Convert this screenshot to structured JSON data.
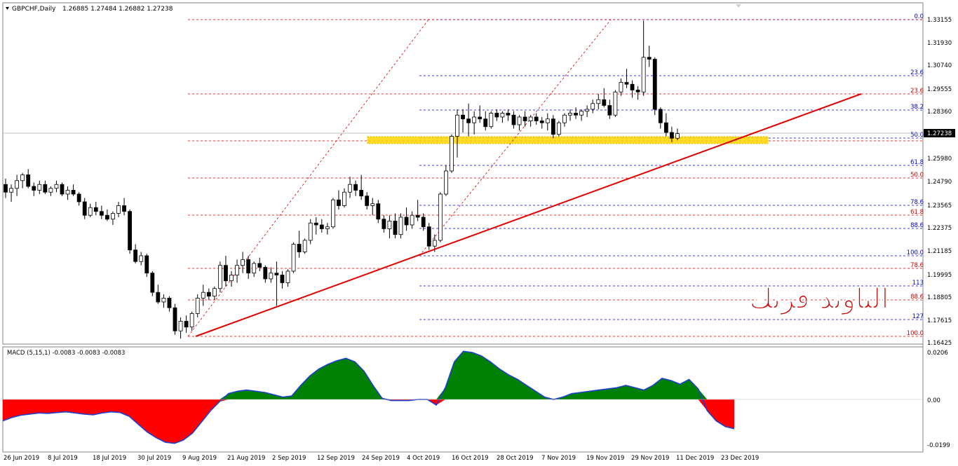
{
  "header": {
    "symbol_label": "GBPCHF,Daily",
    "ohlc_label": "1.26885 1.27484 1.26882 1.27238"
  },
  "macd": {
    "label": "MACD (5,15,1) -0.0083 -0.0083 -0.0083",
    "axis_ticks": [
      "0.0206",
      "0.00",
      "-0.0199"
    ]
  },
  "price_axis": {
    "ticks": [
      "1.33155",
      "1.31930",
      "1.30740",
      "1.29555",
      "1.28360",
      "1.27238",
      "1.25980",
      "1.24790",
      "1.23565",
      "1.22375",
      "1.21185",
      "1.19995",
      "1.18805",
      "1.17615",
      "1.16425"
    ],
    "current_price": "1.27238"
  },
  "time_axis": {
    "labels": [
      "26 Jun 2019",
      "8 Jul 2019",
      "18 Jul 2019",
      "30 Jul 2019",
      "9 Aug 2019",
      "21 Aug 2019",
      "2 Sep 2019",
      "12 Sep 2019",
      "24 Sep 2019",
      "4 Oct 2019",
      "16 Oct 2019",
      "28 Oct 2019",
      "7 Nov 2019",
      "19 Nov 2019",
      "29 Nov 2019",
      "11 Dec 2019",
      "23 Dec 2019"
    ]
  },
  "fib_blue": {
    "label_values": [
      "0.0",
      "23.6",
      "38.2",
      "50.0",
      "61.8",
      "78.6",
      "88.6",
      "100.0",
      "113",
      "127"
    ],
    "color": "#0000cc"
  },
  "fib_red": {
    "label_values": [
      "23.6",
      "50.0",
      "61.8",
      "78.6",
      "88.6",
      "100.0"
    ],
    "color": "#cc0000"
  },
  "watermark": {
    "text": "الباوند فرنك",
    "color": "#cc0000"
  },
  "colors": {
    "trendline": "#e00000",
    "zone_fill": "#ffd700",
    "zone_border": "#e0b000",
    "macd_positive": "#008000",
    "macd_negative": "#ff0000",
    "macd_outline": "#1f3fd0"
  },
  "chart_data": {
    "type": "candlestick",
    "symbol": "GBPCHF",
    "timeframe": "Daily",
    "y_range": [
      1.163,
      1.335
    ],
    "current_price": 1.27238,
    "candles": [
      [
        1.246,
        1.249,
        1.239,
        1.242
      ],
      [
        1.242,
        1.246,
        1.237,
        1.244
      ],
      [
        1.244,
        1.251,
        1.24,
        1.248
      ],
      [
        1.248,
        1.252,
        1.244,
        1.251
      ],
      [
        1.251,
        1.254,
        1.244,
        1.245
      ],
      [
        1.245,
        1.247,
        1.24,
        1.243
      ],
      [
        1.243,
        1.248,
        1.241,
        1.246
      ],
      [
        1.246,
        1.248,
        1.241,
        1.242
      ],
      [
        1.242,
        1.245,
        1.24,
        1.244
      ],
      [
        1.244,
        1.248,
        1.242,
        1.246
      ],
      [
        1.246,
        1.247,
        1.24,
        1.241
      ],
      [
        1.241,
        1.245,
        1.238,
        1.243
      ],
      [
        1.243,
        1.246,
        1.24,
        1.241
      ],
      [
        1.241,
        1.242,
        1.235,
        1.237
      ],
      [
        1.237,
        1.239,
        1.228,
        1.23
      ],
      [
        1.23,
        1.236,
        1.229,
        1.234
      ],
      [
        1.234,
        1.237,
        1.23,
        1.232
      ],
      [
        1.232,
        1.235,
        1.228,
        1.23
      ],
      [
        1.23,
        1.233,
        1.227,
        1.228
      ],
      [
        1.228,
        1.232,
        1.225,
        1.231
      ],
      [
        1.231,
        1.237,
        1.229,
        1.235
      ],
      [
        1.235,
        1.239,
        1.23,
        1.232
      ],
      [
        1.232,
        1.233,
        1.21,
        1.212
      ],
      [
        1.212,
        1.215,
        1.205,
        1.206
      ],
      [
        1.206,
        1.211,
        1.204,
        1.209
      ],
      [
        1.209,
        1.21,
        1.198,
        1.2
      ],
      [
        1.2,
        1.201,
        1.188,
        1.19
      ],
      [
        1.19,
        1.194,
        1.184,
        1.185
      ],
      [
        1.185,
        1.189,
        1.182,
        1.187
      ],
      [
        1.187,
        1.188,
        1.18,
        1.182
      ],
      [
        1.182,
        1.184,
        1.168,
        1.17
      ],
      [
        1.17,
        1.177,
        1.166,
        1.175
      ],
      [
        1.175,
        1.178,
        1.169,
        1.172
      ],
      [
        1.172,
        1.18,
        1.17,
        1.179
      ],
      [
        1.179,
        1.189,
        1.177,
        1.187
      ],
      [
        1.187,
        1.194,
        1.183,
        1.19
      ],
      [
        1.19,
        1.192,
        1.186,
        1.188
      ],
      [
        1.188,
        1.193,
        1.186,
        1.192
      ],
      [
        1.192,
        1.206,
        1.19,
        1.204
      ],
      [
        1.204,
        1.209,
        1.193,
        1.196
      ],
      [
        1.196,
        1.201,
        1.193,
        1.199
      ],
      [
        1.199,
        1.207,
        1.195,
        1.204
      ],
      [
        1.204,
        1.211,
        1.2,
        1.207
      ],
      [
        1.207,
        1.209,
        1.197,
        1.2
      ],
      [
        1.2,
        1.206,
        1.198,
        1.205
      ],
      [
        1.205,
        1.208,
        1.201,
        1.203
      ],
      [
        1.203,
        1.204,
        1.195,
        1.197
      ],
      [
        1.197,
        1.203,
        1.195,
        1.2
      ],
      [
        1.2,
        1.206,
        1.183,
        1.199
      ],
      [
        1.199,
        1.201,
        1.192,
        1.195
      ],
      [
        1.195,
        1.202,
        1.193,
        1.201
      ],
      [
        1.201,
        1.216,
        1.2,
        1.215
      ],
      [
        1.215,
        1.222,
        1.208,
        1.211
      ],
      [
        1.211,
        1.218,
        1.21,
        1.217
      ],
      [
        1.217,
        1.228,
        1.215,
        1.226
      ],
      [
        1.226,
        1.229,
        1.22,
        1.225
      ],
      [
        1.225,
        1.228,
        1.221,
        1.223
      ],
      [
        1.223,
        1.226,
        1.22,
        1.224
      ],
      [
        1.224,
        1.239,
        1.223,
        1.238
      ],
      [
        1.238,
        1.243,
        1.233,
        1.235
      ],
      [
        1.235,
        1.244,
        1.234,
        1.242
      ],
      [
        1.242,
        1.25,
        1.239,
        1.246
      ],
      [
        1.246,
        1.248,
        1.24,
        1.243
      ],
      [
        1.243,
        1.251,
        1.238,
        1.24
      ],
      [
        1.24,
        1.242,
        1.233,
        1.235
      ],
      [
        1.235,
        1.239,
        1.23,
        1.236
      ],
      [
        1.236,
        1.238,
        1.226,
        1.228
      ],
      [
        1.228,
        1.23,
        1.221,
        1.223
      ],
      [
        1.223,
        1.23,
        1.218,
        1.227
      ],
      [
        1.227,
        1.231,
        1.218,
        1.22
      ],
      [
        1.22,
        1.231,
        1.218,
        1.229
      ],
      [
        1.229,
        1.234,
        1.222,
        1.225
      ],
      [
        1.225,
        1.232,
        1.223,
        1.23
      ],
      [
        1.23,
        1.238,
        1.227,
        1.229
      ],
      [
        1.229,
        1.231,
        1.222,
        1.224
      ],
      [
        1.224,
        1.226,
        1.212,
        1.214
      ],
      [
        1.214,
        1.22,
        1.211,
        1.217
      ],
      [
        1.217,
        1.242,
        1.216,
        1.241
      ],
      [
        1.241,
        1.256,
        1.24,
        1.253
      ],
      [
        1.253,
        1.272,
        1.252,
        1.271
      ],
      [
        1.271,
        1.285,
        1.26,
        1.282
      ],
      [
        1.282,
        1.285,
        1.273,
        1.28
      ],
      [
        1.28,
        1.288,
        1.271,
        1.278
      ],
      [
        1.278,
        1.284,
        1.272,
        1.281
      ],
      [
        1.281,
        1.287,
        1.278,
        1.28
      ],
      [
        1.28,
        1.284,
        1.274,
        1.276
      ],
      [
        1.276,
        1.284,
        1.275,
        1.283
      ],
      [
        1.283,
        1.285,
        1.279,
        1.281
      ],
      [
        1.281,
        1.284,
        1.278,
        1.283
      ],
      [
        1.283,
        1.285,
        1.279,
        1.282
      ],
      [
        1.282,
        1.284,
        1.275,
        1.277
      ],
      [
        1.277,
        1.282,
        1.274,
        1.281
      ],
      [
        1.281,
        1.284,
        1.276,
        1.279
      ],
      [
        1.279,
        1.282,
        1.276,
        1.281
      ],
      [
        1.281,
        1.283,
        1.277,
        1.279
      ],
      [
        1.279,
        1.281,
        1.275,
        1.278
      ],
      [
        1.278,
        1.283,
        1.274,
        1.28
      ],
      [
        1.28,
        1.282,
        1.27,
        1.272
      ],
      [
        1.272,
        1.279,
        1.271,
        1.278
      ],
      [
        1.278,
        1.283,
        1.276,
        1.282
      ],
      [
        1.282,
        1.285,
        1.279,
        1.283
      ],
      [
        1.283,
        1.286,
        1.28,
        1.282
      ],
      [
        1.282,
        1.285,
        1.279,
        1.284
      ],
      [
        1.284,
        1.287,
        1.281,
        1.285
      ],
      [
        1.285,
        1.29,
        1.283,
        1.288
      ],
      [
        1.288,
        1.293,
        1.285,
        1.29
      ],
      [
        1.29,
        1.296,
        1.286,
        1.287
      ],
      [
        1.287,
        1.29,
        1.28,
        1.282
      ],
      [
        1.282,
        1.295,
        1.281,
        1.294
      ],
      [
        1.294,
        1.301,
        1.292,
        1.299
      ],
      [
        1.299,
        1.306,
        1.296,
        1.298
      ],
      [
        1.298,
        1.3,
        1.291,
        1.295
      ],
      [
        1.295,
        1.297,
        1.29,
        1.294
      ],
      [
        1.294,
        1.331,
        1.292,
        1.312
      ],
      [
        1.312,
        1.318,
        1.307,
        1.311
      ],
      [
        1.311,
        1.312,
        1.282,
        1.285
      ],
      [
        1.285,
        1.286,
        1.275,
        1.278
      ],
      [
        1.278,
        1.283,
        1.271,
        1.273
      ],
      [
        1.273,
        1.276,
        1.268,
        1.27
      ],
      [
        1.27,
        1.275,
        1.269,
        1.2724
      ]
    ]
  },
  "macd_data": {
    "type": "area",
    "range": [
      -0.0199,
      0.0206
    ],
    "values": [
      -0.0095,
      -0.008,
      -0.007,
      -0.0065,
      -0.006,
      -0.0062,
      -0.0058,
      -0.0055,
      -0.006,
      -0.0065,
      -0.0068,
      -0.006,
      -0.0055,
      -0.0058,
      -0.0075,
      -0.011,
      -0.0145,
      -0.017,
      -0.019,
      -0.0195,
      -0.018,
      -0.015,
      -0.01,
      -0.005,
      -0.001,
      0.0025,
      0.0035,
      0.004,
      0.0035,
      0.003,
      0.002,
      0.001,
      0.0015,
      0.006,
      0.01,
      0.013,
      0.015,
      0.0165,
      0.0175,
      0.016,
      0.012,
      0.006,
      0.0005,
      -0.0005,
      -0.0005,
      -0.0005,
      0.0,
      0.0,
      -0.0025,
      0.005,
      0.016,
      0.0205,
      0.02,
      0.0185,
      0.016,
      0.013,
      0.0105,
      0.0085,
      0.006,
      0.0035,
      0.001,
      0.0,
      0.001,
      0.0025,
      0.003,
      0.0035,
      0.004,
      0.0045,
      0.005,
      0.006,
      0.005,
      0.004,
      0.006,
      0.009,
      0.008,
      0.0065,
      0.0085,
      0.0045,
      -0.005,
      -0.0095,
      -0.012,
      -0.013
    ]
  }
}
